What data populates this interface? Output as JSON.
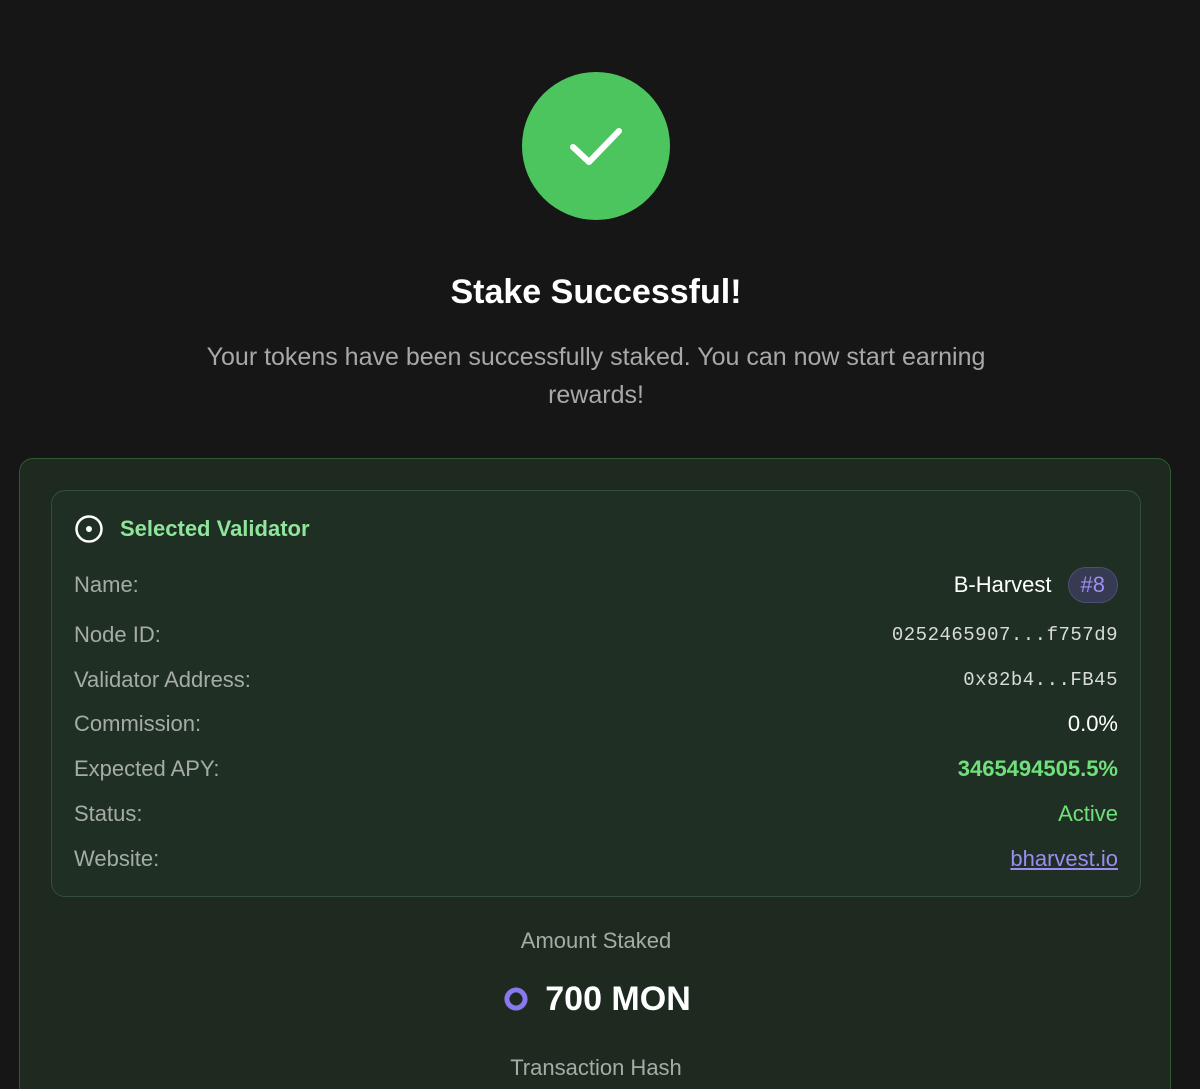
{
  "status": {
    "icon": "check-icon",
    "color": "#4cc55f",
    "title": "Stake Successful!",
    "message": "Your tokens have been successfully staked. You can now start earning rewards!"
  },
  "validator": {
    "header_icon": "target-icon",
    "header_label": "Selected Validator",
    "rows": {
      "name": {
        "label": "Name:",
        "value": "B-Harvest",
        "rank": "#8"
      },
      "node_id": {
        "label": "Node ID:",
        "value": "0252465907...f757d9"
      },
      "address": {
        "label": "Validator Address:",
        "value": "0x82b4...FB45"
      },
      "commission": {
        "label": "Commission:",
        "value": "0.0%"
      },
      "apy": {
        "label": "Expected APY:",
        "value": "3465494505.5%"
      },
      "status": {
        "label": "Status:",
        "value": "Active"
      },
      "website": {
        "label": "Website:",
        "value": "bharvest.io"
      }
    }
  },
  "stake": {
    "amount_label": "Amount Staked",
    "amount_icon": "mon-token-icon",
    "amount": "700 MON",
    "hash_label": "Transaction Hash"
  },
  "colors": {
    "background": "#161616",
    "success": "#4cc55f",
    "accent_green": "#6fe07b",
    "accent_purple": "#9a8cf0"
  }
}
